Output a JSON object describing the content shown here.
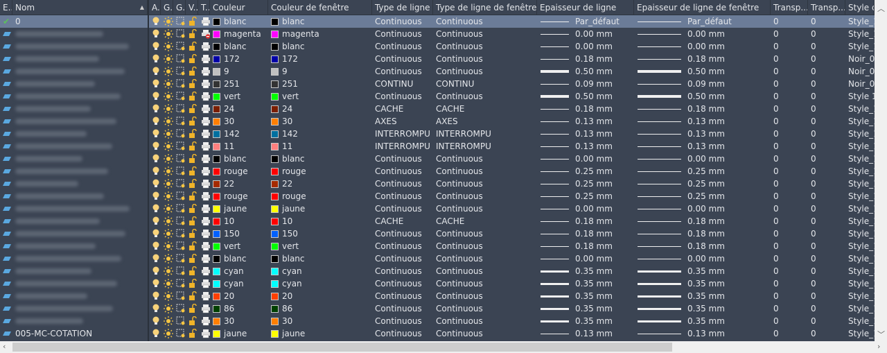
{
  "headers": [
    "E..",
    "Nom",
    "A.",
    "G.",
    "G.",
    "V..",
    "T..",
    "Couleur",
    "Couleur de fenêtre",
    "Type de ligne",
    "Type de ligne de fenêtre",
    "Epaisseur de ligne",
    "Epaisseur de ligne de fenêtre",
    "Transp...",
    "Transp...",
    "Style d..."
  ],
  "rows": [
    {
      "name": "0",
      "current": true,
      "color": "blanc",
      "hex": "#000000",
      "lt": "Continuous",
      "lw": "Par_défaut",
      "tr": "0",
      "tr2": "0",
      "style": "Style_1"
    },
    {
      "name": "",
      "color": "magenta",
      "hex": "#ff00ff",
      "lt": "Continuous",
      "lw": "0.00 mm",
      "tr": "0",
      "tr2": "0",
      "style": "Style_1",
      "noplot": true
    },
    {
      "name": "",
      "color": "blanc",
      "hex": "#000000",
      "lt": "Continuous",
      "lw": "0.00 mm",
      "tr": "0",
      "tr2": "0",
      "style": "Style_1"
    },
    {
      "name": "",
      "color": "172",
      "hex": "#0000a8",
      "lt": "Continuous",
      "lw": "0.18 mm",
      "tr": "0",
      "tr2": "0",
      "style": "Noir_0."
    },
    {
      "name": "",
      "color": "9",
      "hex": "#c0c0c0",
      "lt": "Continuous",
      "lw": "0.50 mm",
      "tr": "0",
      "tr2": "0",
      "style": "Noir_0."
    },
    {
      "name": "",
      "color": "251",
      "hex": "#333333",
      "lt": "CONTINU",
      "lw": "0.09 mm",
      "tr": "0",
      "tr2": "0",
      "style": "Noir_0."
    },
    {
      "name": "",
      "color": "vert",
      "hex": "#00ff00",
      "lt": "Continuous",
      "lw": "0.50 mm",
      "tr": "0",
      "tr2": "0",
      "style": "Style 1"
    },
    {
      "name": "",
      "color": "24",
      "hex": "#7a1e00",
      "lt": "CACHE",
      "lw": "0.18 mm",
      "tr": "0",
      "tr2": "0",
      "style": "Style_1"
    },
    {
      "name": "",
      "color": "30",
      "hex": "#ff7f00",
      "lt": "AXES",
      "lw": "0.13 mm",
      "tr": "0",
      "tr2": "0",
      "style": "Style_1"
    },
    {
      "name": "",
      "color": "142",
      "hex": "#0070a0",
      "lt": "INTERROMPU",
      "lw": "0.13 mm",
      "tr": "0",
      "tr2": "0",
      "style": "Style_1"
    },
    {
      "name": "",
      "color": "11",
      "hex": "#ff7f7f",
      "lt": "INTERROMPU",
      "lw": "0.13 mm",
      "tr": "0",
      "tr2": "0",
      "style": "Style_1"
    },
    {
      "name": "",
      "color": "blanc",
      "hex": "#000000",
      "lt": "Continuous",
      "lw": "0.00 mm",
      "tr": "0",
      "tr2": "0",
      "style": "Style_1"
    },
    {
      "name": "",
      "color": "rouge",
      "hex": "#ff0000",
      "lt": "Continuous",
      "lw": "0.25 mm",
      "tr": "0",
      "tr2": "0",
      "style": "Style_1"
    },
    {
      "name": "",
      "color": "22",
      "hex": "#a52a00",
      "lt": "Continuous",
      "lw": "0.25 mm",
      "tr": "0",
      "tr2": "0",
      "style": "Style_1"
    },
    {
      "name": "",
      "color": "rouge",
      "hex": "#ff0000",
      "lt": "Continuous",
      "lw": "0.25 mm",
      "tr": "0",
      "tr2": "0",
      "style": "Style_1"
    },
    {
      "name": "",
      "color": "jaune",
      "hex": "#ffff00",
      "lt": "Continuous",
      "lw": "0.00 mm",
      "tr": "0",
      "tr2": "0",
      "style": "Style_1"
    },
    {
      "name": "",
      "color": "10",
      "hex": "#ff0000",
      "lt": "CACHE",
      "lw": "0.18 mm",
      "tr": "0",
      "tr2": "0",
      "style": "Style_1"
    },
    {
      "name": "",
      "color": "150",
      "hex": "#0060ff",
      "lt": "Continuous",
      "lw": "0.18 mm",
      "tr": "0",
      "tr2": "0",
      "style": "Style_1"
    },
    {
      "name": "",
      "color": "vert",
      "hex": "#00ff00",
      "lt": "Continuous",
      "lw": "0.18 mm",
      "tr": "0",
      "tr2": "0",
      "style": "Style_1"
    },
    {
      "name": "",
      "color": "blanc",
      "hex": "#000000",
      "lt": "Continuous",
      "lw": "0.00 mm",
      "tr": "0",
      "tr2": "0",
      "style": "Style_1"
    },
    {
      "name": "",
      "color": "cyan",
      "hex": "#00ffff",
      "lt": "Continuous",
      "lw": "0.35 mm",
      "tr": "0",
      "tr2": "0",
      "style": "Style_1"
    },
    {
      "name": "",
      "color": "cyan",
      "hex": "#00ffff",
      "lt": "Continuous",
      "lw": "0.35 mm",
      "tr": "0",
      "tr2": "0",
      "style": "Style_1"
    },
    {
      "name": "",
      "color": "20",
      "hex": "#ff3f00",
      "lt": "Continuous",
      "lw": "0.35 mm",
      "tr": "0",
      "tr2": "0",
      "style": "Style_1"
    },
    {
      "name": "",
      "color": "86",
      "hex": "#004000",
      "lt": "Continuous",
      "lw": "0.35 mm",
      "tr": "0",
      "tr2": "0",
      "style": "Style_1"
    },
    {
      "name": "",
      "color": "30",
      "hex": "#ff7f00",
      "lt": "Continuous",
      "lw": "0.35 mm",
      "tr": "0",
      "tr2": "0",
      "style": "Style_1"
    },
    {
      "name": "005-MC-COTATION",
      "color": "jaune",
      "hex": "#ffff00",
      "lt": "Continuous",
      "lw": "0.13 mm",
      "tr": "0",
      "tr2": "0",
      "style": "Style_1"
    }
  ]
}
